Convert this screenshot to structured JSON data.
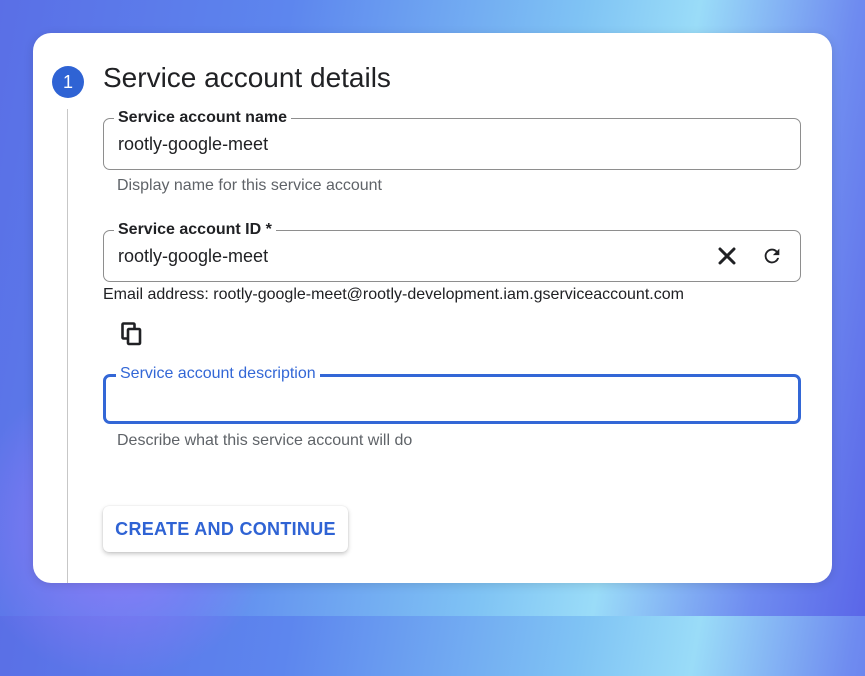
{
  "step": {
    "number": "1",
    "title": "Service account details"
  },
  "fields": {
    "name": {
      "label": "Service account name",
      "value": "rootly-google-meet",
      "helper": "Display name for this service account"
    },
    "id": {
      "label": "Service account ID *",
      "value": "rootly-google-meet",
      "email_text": "Email address: rootly-google-meet@rootly-development.iam.gserviceaccount.com"
    },
    "description": {
      "label": "Service account description",
      "value": "",
      "helper": "Describe what this service account will do"
    }
  },
  "actions": {
    "create_continue": "CREATE AND CONTINUE"
  },
  "icons": [
    "clear-icon",
    "refresh-icon",
    "copy-icon"
  ],
  "colors": {
    "accent": "#2f63d4",
    "focus": "#3367d6",
    "text": "#202124",
    "helper": "#5f6368"
  }
}
